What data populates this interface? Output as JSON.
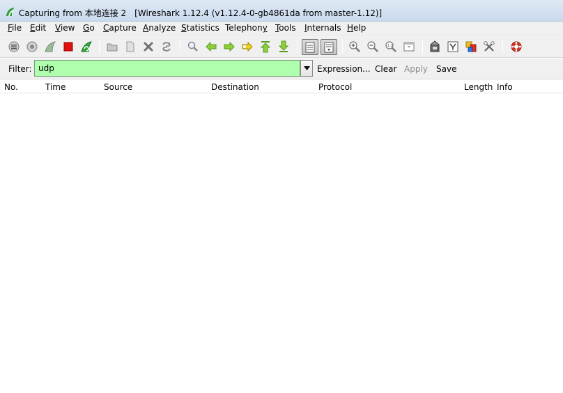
{
  "window": {
    "title": "Capturing from 本地连接 2",
    "version": "[Wireshark 1.12.4  (v1.12.4-0-gb4861da from master-1.12)]"
  },
  "menu": [
    {
      "mn": "F",
      "rest": "ile"
    },
    {
      "mn": "E",
      "rest": "dit"
    },
    {
      "mn": "V",
      "rest": "iew"
    },
    {
      "mn": "G",
      "rest": "o"
    },
    {
      "mn": "C",
      "rest": "apture"
    },
    {
      "mn": "A",
      "rest": "nalyze"
    },
    {
      "mn": "S",
      "rest": "tatistics"
    },
    {
      "pre": "Telephon",
      "mn": "y",
      "rest": ""
    },
    {
      "mn": "T",
      "rest": "ools"
    },
    {
      "mn": "I",
      "rest": "nternals"
    },
    {
      "mn": "H",
      "rest": "elp"
    }
  ],
  "filter": {
    "label": "Filter:",
    "value": "udp",
    "expression_label": "Expression...",
    "clear_label": "Clear",
    "apply_label": "Apply",
    "save_label": "Save"
  },
  "columns": [
    "No.",
    "Time",
    "Source",
    "Destination",
    "Protocol",
    "Length",
    "Info"
  ],
  "colors": {
    "filter_valid_bg": "#afffaf"
  }
}
